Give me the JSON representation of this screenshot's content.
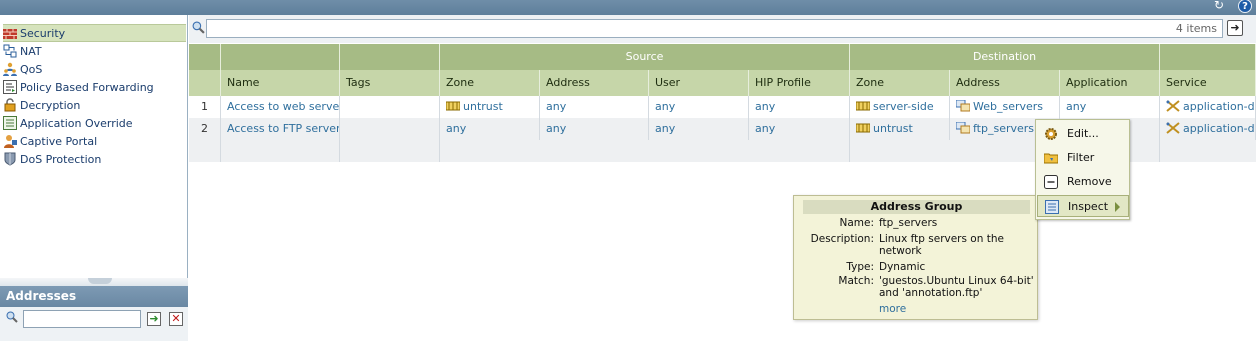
{
  "sidebar": {
    "items": [
      {
        "label": "Security",
        "icon": "firewall-brick-icon",
        "active": true
      },
      {
        "label": "NAT",
        "icon": "nat-arrows-icon"
      },
      {
        "label": "QoS",
        "icon": "qos-users-icon"
      },
      {
        "label": "Policy Based Forwarding",
        "icon": "forwarding-icon"
      },
      {
        "label": "Decryption",
        "icon": "lock-icon"
      },
      {
        "label": "Application Override",
        "icon": "application-override-icon"
      },
      {
        "label": "Captive Portal",
        "icon": "captive-portal-icon"
      },
      {
        "label": "DoS Protection",
        "icon": "dos-shield-icon"
      }
    ],
    "addresses_header": "Addresses"
  },
  "filter": {
    "count_text": "4 items"
  },
  "table": {
    "group_headers": {
      "source": "Source",
      "destination": "Destination"
    },
    "columns": [
      "",
      "Name",
      "Tags",
      "Zone",
      "Address",
      "User",
      "HIP Profile",
      "Zone",
      "Address",
      "Application",
      "Service"
    ],
    "rows": [
      {
        "num": "1",
        "name": "Access to web servers",
        "tags": "",
        "src_zone": "untrust",
        "src_address": "any",
        "user": "any",
        "hip": "any",
        "dst_zone": "server-side",
        "dst_address": "Web_servers",
        "application": "any",
        "service": "application-d..."
      },
      {
        "num": "2",
        "name": "Access to FTP servers",
        "tags": "",
        "src_zone": "any",
        "src_address": "any",
        "user": "any",
        "hip": "any",
        "dst_zone": "untrust",
        "dst_address": "ftp_servers",
        "application": "",
        "service": "application-d..."
      }
    ]
  },
  "context_menu": {
    "items": [
      {
        "label": "Edit...",
        "icon": "edit-gear-icon"
      },
      {
        "label": "Filter",
        "icon": "filter-folder-icon"
      },
      {
        "label": "Remove",
        "icon": "remove-minus-icon"
      },
      {
        "label": "Inspect",
        "icon": "inspect-list-icon",
        "highlighted": true
      }
    ]
  },
  "tooltip": {
    "title": "Address Group",
    "name_key": "Name:",
    "name_val": "ftp_servers",
    "desc_key": "Description:",
    "desc_val": "Linux ftp servers on the network",
    "type_key": "Type:",
    "type_val": "Dynamic",
    "match_key": "Match:",
    "match_val": "'guestos.Ubuntu Linux 64-bit' and 'annotation.ftp'",
    "more": "more"
  }
}
